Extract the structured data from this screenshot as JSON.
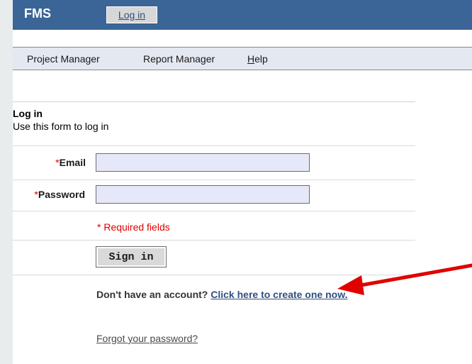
{
  "header": {
    "brand": "FMS",
    "login_label": "Log in"
  },
  "menu": {
    "items": [
      {
        "label": "Project Manager"
      },
      {
        "label": "Report Manager"
      },
      {
        "label_underlined": "H",
        "label_rest": "elp"
      }
    ]
  },
  "form": {
    "title": "Log in",
    "subtitle": "Use this form to log in",
    "email": {
      "star": "*",
      "label": "Email",
      "value": ""
    },
    "password": {
      "star": "*",
      "label": "Password",
      "value": ""
    },
    "required_note": "* Required fields",
    "signin_label": "Sign in",
    "account_prompt": "Don't have an account?",
    "create_link": "Click here to create one now.",
    "forgot_link": "Forgot your password?"
  },
  "colors": {
    "header_bg": "#3a6596",
    "menu_bg": "#e4e8f1",
    "required_red": "#e00000",
    "arrow_red": "#e00000"
  }
}
